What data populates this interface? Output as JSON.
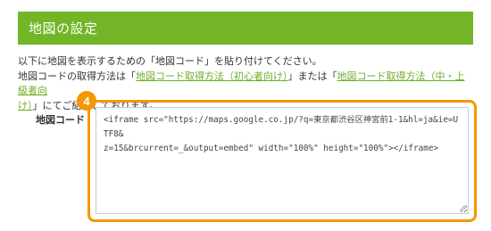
{
  "header": {
    "title": "地図の設定"
  },
  "intro": {
    "line1": "以下に地図を表示するための「地図コード」を貼り付けてください。",
    "line2_prefix": "地図コードの取得方法は「",
    "link_beginner": "地図コード取得方法（初心者向け）",
    "line2_middle": "」または「",
    "link_advanced_part1": "地図コード取得方法（中・上級者向",
    "link_advanced_part2": "け）",
    "line2_suffix": "」にてご紹介しております。"
  },
  "map_code": {
    "label": "地図コード",
    "step_number": "4",
    "value_line1": "<iframe src=\"https://maps.google.co.jp/?q=東京都渋谷区神宮前1-1&hl=ja&ie=UTF8&",
    "value_line2": "z=15&brcurrent=_&output=embed\" width=\"100%\" height=\"100%\"></iframe>"
  },
  "colors": {
    "header_bg": "#72b526",
    "link": "#6fae27",
    "highlight": "#f39800"
  }
}
